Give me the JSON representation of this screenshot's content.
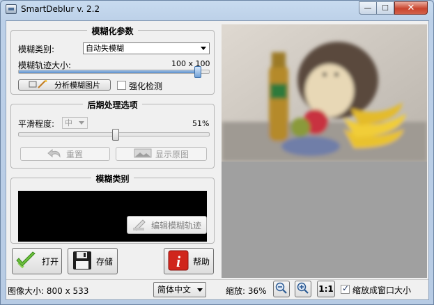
{
  "window": {
    "title": "SmartDeblur v. 2.2",
    "min_label": "—",
    "max_label": "☐",
    "close_label": "✕"
  },
  "blur_params": {
    "title": "模糊化参数",
    "type_label": "模糊类别:",
    "type_value": "自动失模糊",
    "size_label": "模糊轨迹大小:",
    "size_value": "100 x 100",
    "size_percent": 96,
    "analyze_label": "分析模糊图片",
    "enhance_label": "强化检测",
    "enhance_checked": false
  },
  "post": {
    "title": "后期处理选项",
    "smooth_label": "平滑程度:",
    "smooth_value": "中",
    "smooth_percent": "51%",
    "smooth_level": 51,
    "reset_label": "重置",
    "show_original_label": "显示原图"
  },
  "blur_type": {
    "title": "模糊类别",
    "edit_label": "编辑模糊轨迹"
  },
  "actions": {
    "open_label": "打开",
    "save_label": "存储",
    "help_label": "帮助"
  },
  "status": {
    "image_size": "图像大小: 800 x 533",
    "language": "简体中文",
    "zoom": "缩放: 36%",
    "one_to_one": "1:1",
    "fit_label": "缩放成窗口大小",
    "fit_checked": true
  }
}
